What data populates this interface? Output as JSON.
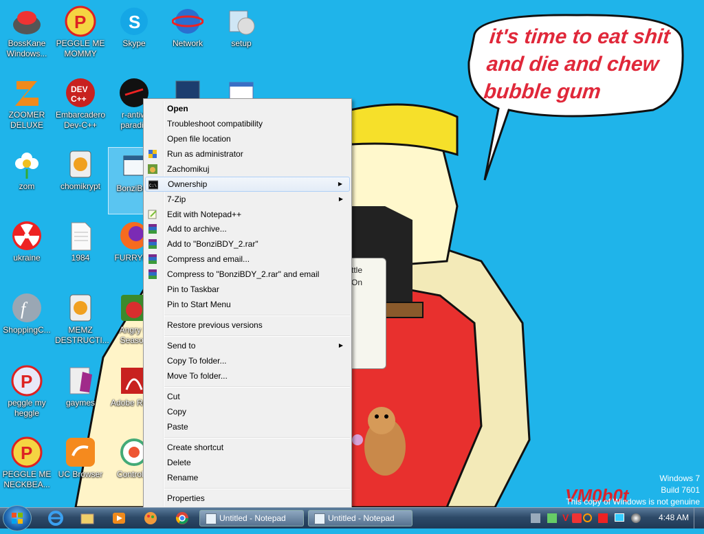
{
  "desktop": {
    "speech_text": "it's time to eat shit and die and chew bubble gum",
    "watermark": "VM0b0t",
    "windows_version": [
      "Windows 7",
      "Build 7601",
      "This copy of Windows is not genuine"
    ],
    "behind_dialog": [
      "ttle",
      "On"
    ],
    "icons": [
      {
        "label": "BossKane Windows...",
        "icon": "bosskane-icon"
      },
      {
        "label": "PEGGLE ME MOMMY",
        "icon": "peggle-icon"
      },
      {
        "label": "Skype",
        "icon": "skype-icon"
      },
      {
        "label": "Network",
        "icon": "network-icon"
      },
      {
        "label": "setup",
        "icon": "setup-icon"
      },
      {
        "label": "ZOOMER DELUXE",
        "icon": "zoomer-icon"
      },
      {
        "label": "Embarcadero Dev-C++",
        "icon": "devcpp-icon"
      },
      {
        "label": "r-antiw paradis",
        "icon": "r-antiw-icon"
      },
      {
        "label": "zom",
        "icon": "flower-icon"
      },
      {
        "label": "chomikrypt",
        "icon": "chomikrypt-icon"
      },
      {
        "label": "BonziBud",
        "icon": "bonzibuddy-icon"
      },
      {
        "label": "ukraine",
        "icon": "radiation-icon"
      },
      {
        "label": "1984",
        "icon": "text-file-icon"
      },
      {
        "label": "FURRYFU",
        "icon": "firefox-icon"
      },
      {
        "label": "ShoppingC...",
        "icon": "flash-icon"
      },
      {
        "label": "MEMZ DESTRUCTI...",
        "icon": "memz-icon"
      },
      {
        "label": "Angry B Season",
        "icon": "angry-birds-icon"
      },
      {
        "label": "peggle my heggle",
        "icon": "peggle-icon"
      },
      {
        "label": "gaymes",
        "icon": "games-folder-icon"
      },
      {
        "label": "Adobe Re XI",
        "icon": "adobe-reader-icon"
      },
      {
        "label": "PEGGLE ME NECKBEA...",
        "icon": "peggle-icon"
      },
      {
        "label": "UC Browser",
        "icon": "uc-browser-icon"
      },
      {
        "label": "Control P",
        "icon": "control-panel-icon"
      }
    ]
  },
  "context_menu": {
    "items": [
      {
        "label": "Open",
        "bold": true
      },
      {
        "label": "Troubleshoot compatibility"
      },
      {
        "label": "Open file location"
      },
      {
        "label": "Run as administrator",
        "icon": "shield-icon"
      },
      {
        "label": "Zachomikuj",
        "icon": "chomikuj-icon"
      },
      {
        "label": "Ownership",
        "icon": "cmd-icon",
        "submenu": true,
        "highlighted": true
      },
      {
        "label": "7-Zip",
        "submenu": true
      },
      {
        "label": "Edit with Notepad++",
        "icon": "notepadpp-icon"
      },
      {
        "label": "Add to archive...",
        "icon": "winrar-icon"
      },
      {
        "label": "Add to \"BonziBDY_2.rar\"",
        "icon": "winrar-icon"
      },
      {
        "label": "Compress and email...",
        "icon": "winrar-icon"
      },
      {
        "label": "Compress to \"BonziBDY_2.rar\" and email",
        "icon": "winrar-icon"
      },
      {
        "label": "Pin to Taskbar"
      },
      {
        "label": "Pin to Start Menu"
      },
      {
        "label": "Restore previous versions"
      },
      {
        "label": "Send to",
        "submenu": true
      },
      {
        "label": "Copy To folder..."
      },
      {
        "label": "Move To folder..."
      },
      {
        "label": "Cut"
      },
      {
        "label": "Copy"
      },
      {
        "label": "Paste"
      },
      {
        "label": "Create shortcut"
      },
      {
        "label": "Delete"
      },
      {
        "label": "Rename"
      },
      {
        "label": "Properties"
      }
    ]
  },
  "taskbar": {
    "pinned": [
      "internet-explorer-icon",
      "explorer-folder-icon",
      "media-player-icon",
      "paint-icon",
      "chrome-icon"
    ],
    "tasks": [
      {
        "label": "Untitled - Notepad"
      },
      {
        "label": "Untitled - Notepad"
      }
    ],
    "tray_icons": [
      "network-tray-icon",
      "recycle-tray-icon",
      "v-tray-icon",
      "av-tray-icon",
      "search-tray-icon",
      "flag-tray-icon",
      "monitor-tray-icon",
      "volume-tray-icon"
    ],
    "clock": "4:48 AM"
  }
}
